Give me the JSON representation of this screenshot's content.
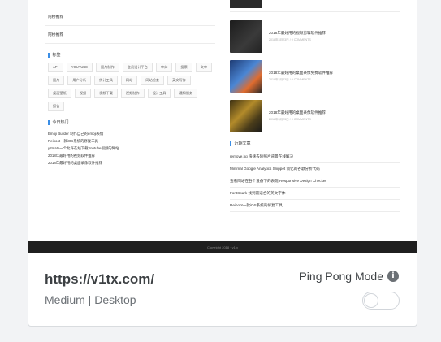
{
  "left": {
    "top_links": [
      "阿桥推荐",
      "阿桥推荐"
    ],
    "tags_heading": "标签",
    "tags": [
      "API",
      "YOUTUBE",
      "图片制作",
      "会员设计平台",
      "字体",
      "投票",
      "文字",
      "图片",
      "用户分析",
      "统计工具",
      "网站",
      "网站检查",
      "英文写作",
      "桌面壁纸",
      "视频",
      "视频下载",
      "视频制作",
      "设计工具",
      "通知服务",
      "报告"
    ],
    "hot_heading": "今日热门",
    "hot_items": [
      "Emoji Builder 制作自己的emoji表情",
      "Reiboot一款iOS系统的修复工具",
      "y2mate一个允许在线下载Youtube视频的网站",
      "2018年最好用的视频软件推荐",
      "2018年最好用的桌面录像软件推荐"
    ]
  },
  "right": {
    "posts": [
      {
        "title": "2018年最好用的视频剪辑软件推荐",
        "meta": "2018年3月23日 / 0 COMMENTS",
        "color": "#2b2b2b"
      },
      {
        "title": "2018年最好用的桌面录像免费软件推荐",
        "meta": "2018年3月23日 / 0 COMMENTS",
        "color": "#3d6fb6"
      },
      {
        "title": "2018年最好用的桌面录像软件推荐",
        "meta": "2018年3月23日 / 0 COMMENTS",
        "color": "#5b4a1e"
      }
    ],
    "recent_heading": "近期文章",
    "recent_items": [
      "remove.bg 快速去除照片背景在线解决",
      "Minimal Google Analytics Snippet 简化的谷歌分析代码",
      "查看网站在各个设备下的表现 Responsive Design Checker",
      "FontSpark 找到最适合的英文字体",
      "Reiboot一款iOS系统的修复工具"
    ]
  },
  "footer": "Copyright 2018 · v1tx",
  "site": {
    "url": "https://v1tx.com/",
    "meta": "Medium | Desktop",
    "mode_label": "Ping Pong Mode",
    "mode_on": false
  }
}
